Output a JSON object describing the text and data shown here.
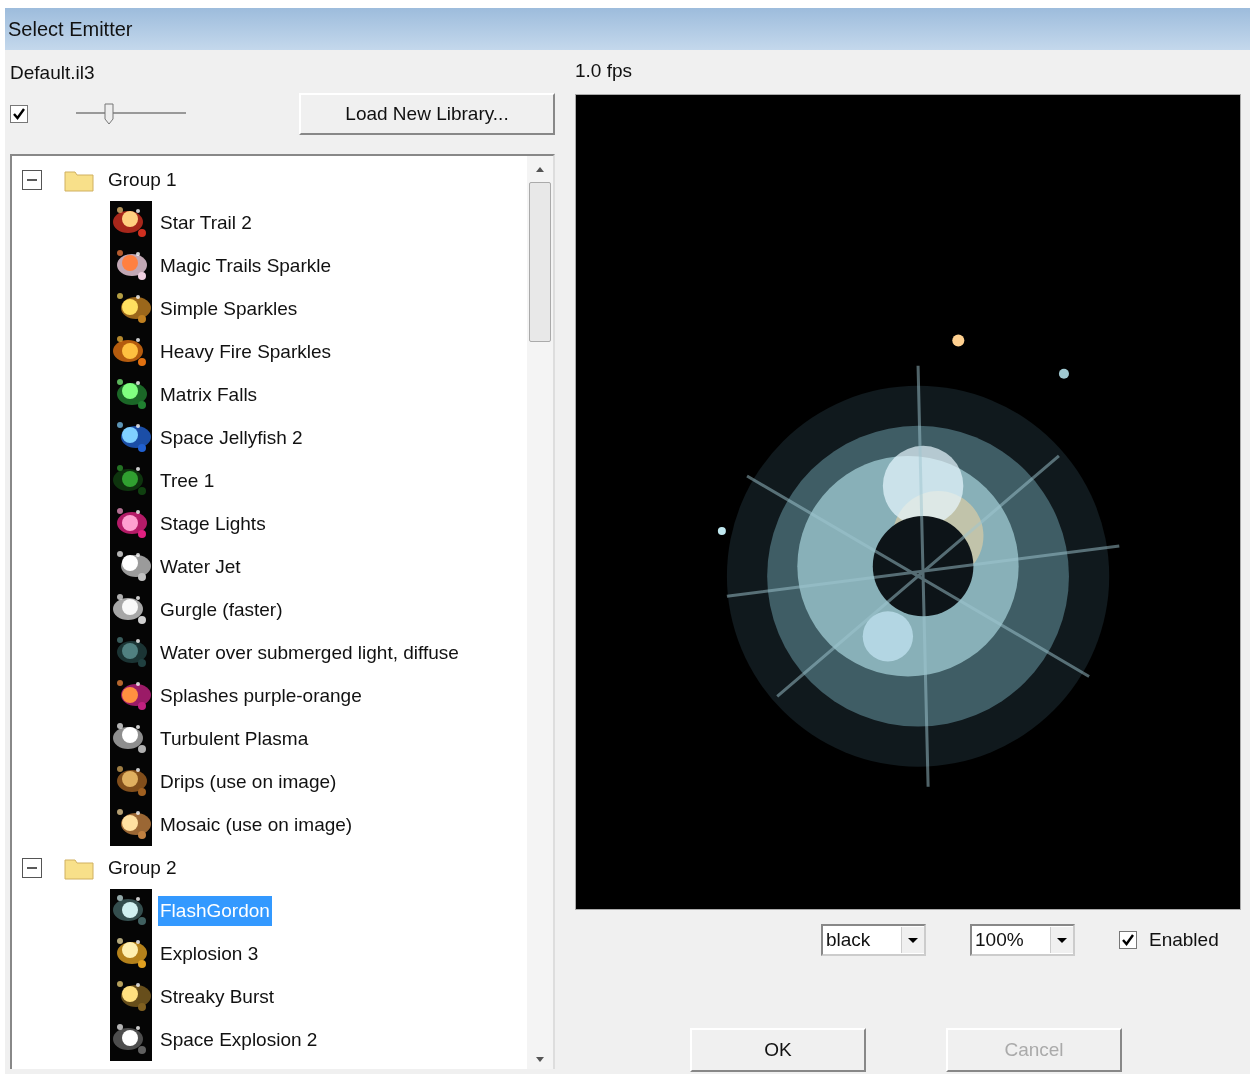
{
  "window": {
    "title": "Select Emitter"
  },
  "library": {
    "name": "Default.il3",
    "checked": true,
    "level": 0.3,
    "load_button": "Load New Library..."
  },
  "tree": [
    {
      "label": "Group 1",
      "expanded": true,
      "children": [
        {
          "label": "Star Trail 2",
          "selected": false
        },
        {
          "label": "Magic Trails Sparkle",
          "selected": false
        },
        {
          "label": "Simple Sparkles",
          "selected": false
        },
        {
          "label": "Heavy Fire Sparkles",
          "selected": false
        },
        {
          "label": "Matrix Falls",
          "selected": false
        },
        {
          "label": "Space Jellyfish 2",
          "selected": false
        },
        {
          "label": "Tree 1",
          "selected": false
        },
        {
          "label": "Stage Lights",
          "selected": false
        },
        {
          "label": "Water Jet",
          "selected": false
        },
        {
          "label": "Gurgle (faster)",
          "selected": false
        },
        {
          "label": "Water over submerged light, diffuse",
          "selected": false
        },
        {
          "label": "Splashes purple-orange",
          "selected": false
        },
        {
          "label": "Turbulent Plasma",
          "selected": false
        },
        {
          "label": "Drips (use on image)",
          "selected": false
        },
        {
          "label": "Mosaic (use on image)",
          "selected": false
        }
      ]
    },
    {
      "label": "Group 2",
      "expanded": true,
      "children": [
        {
          "label": "FlashGordon",
          "selected": true
        },
        {
          "label": "Explosion 3",
          "selected": false
        },
        {
          "label": "Streaky Burst",
          "selected": false
        },
        {
          "label": "Space Explosion 2",
          "selected": false
        }
      ]
    }
  ],
  "preview": {
    "fps": "1.0 fps",
    "background": "black",
    "zoom": "100%",
    "enabled": true,
    "enabled_label": "Enabled"
  },
  "buttons": [
    {
      "label": "OK",
      "disabled": false
    },
    {
      "label": "Cancel",
      "disabled": true
    }
  ]
}
